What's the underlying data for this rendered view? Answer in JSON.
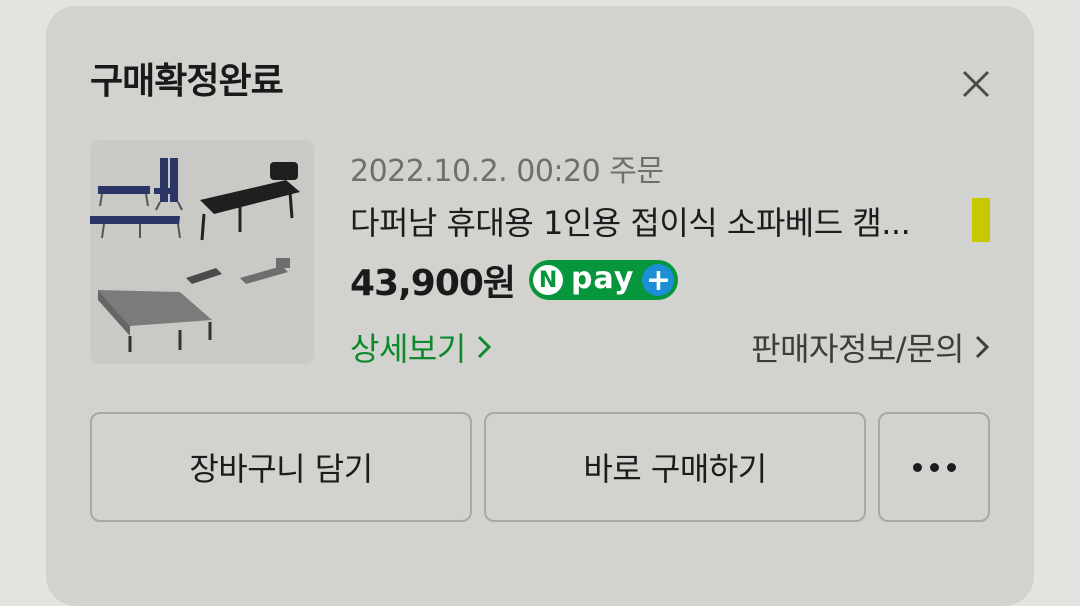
{
  "dialog": {
    "title": "구매확정완료",
    "close_icon": "close-icon"
  },
  "product": {
    "order_date": "2022.10.2. 00:20 주문",
    "name": "다퍼남 휴대용 1인용 접이식 소파베드 캠...",
    "price": "43,900원",
    "badge": {
      "n": "N",
      "pay": "pay",
      "plus": "+"
    },
    "image_icon": "folding-bed-product-image",
    "highlight_color": "#c8c800"
  },
  "links": {
    "detail": "상세보기",
    "seller": "판매자정보/문의"
  },
  "buttons": {
    "cart": "장바구니 담기",
    "buy": "바로 구매하기",
    "more_icon": "more-dots-icon"
  },
  "colors": {
    "accent_green": "#0e8a2e",
    "npay_green": "#07963c",
    "npay_blue": "#1d8fd6"
  }
}
